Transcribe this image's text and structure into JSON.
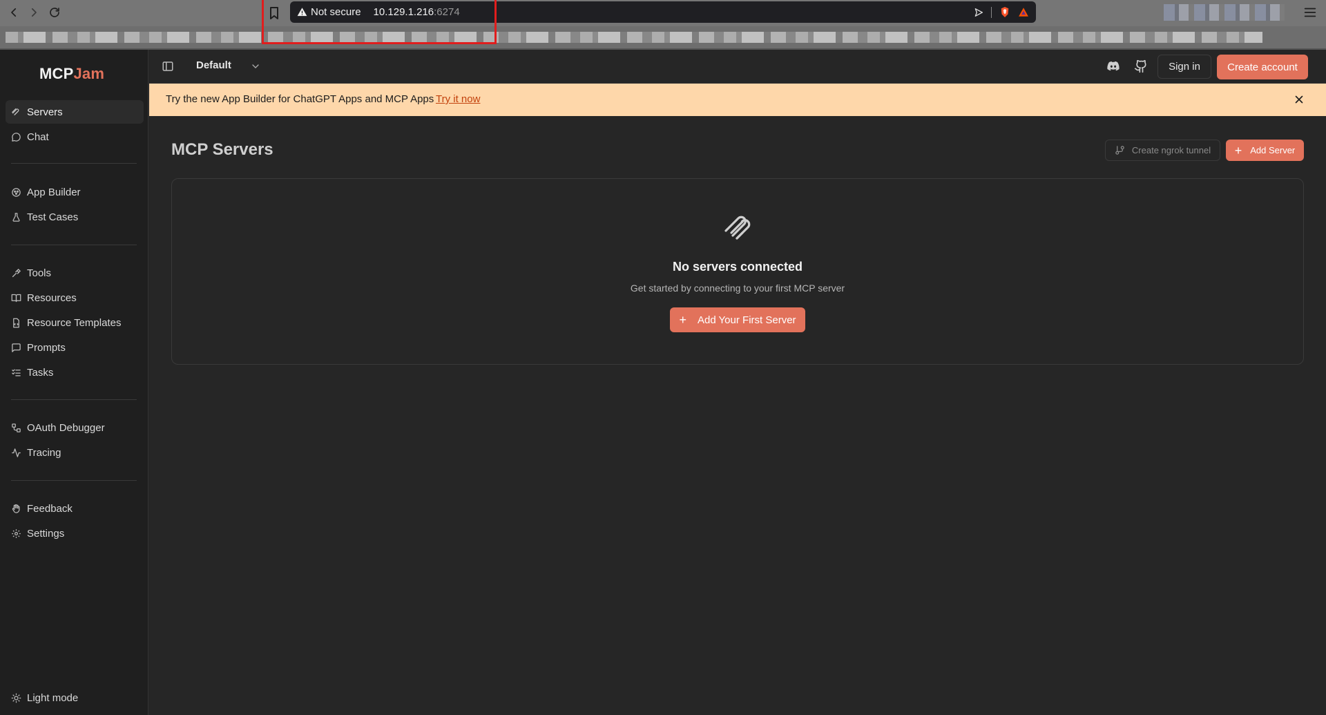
{
  "browser": {
    "url_warning": "Not secure",
    "url_host": "10.129.1.216",
    "url_port": ":6274"
  },
  "app": {
    "logo_prefix": "MCP",
    "logo_suffix": "Jam",
    "accent_color": "#e2725b",
    "workspace": "Default",
    "signin_label": "Sign in",
    "create_account_label": "Create account"
  },
  "banner": {
    "text": "Try the new App Builder for ChatGPT Apps and MCP Apps",
    "link": "Try it now"
  },
  "sidebar": {
    "servers": "Servers",
    "chat": "Chat",
    "app_builder": "App Builder",
    "test_cases": "Test Cases",
    "tools": "Tools",
    "resources": "Resources",
    "resource_templates": "Resource Templates",
    "prompts": "Prompts",
    "tasks": "Tasks",
    "oauth_debugger": "OAuth Debugger",
    "tracing": "Tracing",
    "feedback": "Feedback",
    "settings": "Settings",
    "light_mode": "Light mode"
  },
  "main": {
    "title": "MCP Servers",
    "ngrok_label": "Create ngrok tunnel",
    "add_server_label": "Add Server",
    "empty_title": "No servers connected",
    "empty_subtitle": "Get started by connecting to your first MCP server",
    "first_server_label": "Add Your First Server"
  }
}
